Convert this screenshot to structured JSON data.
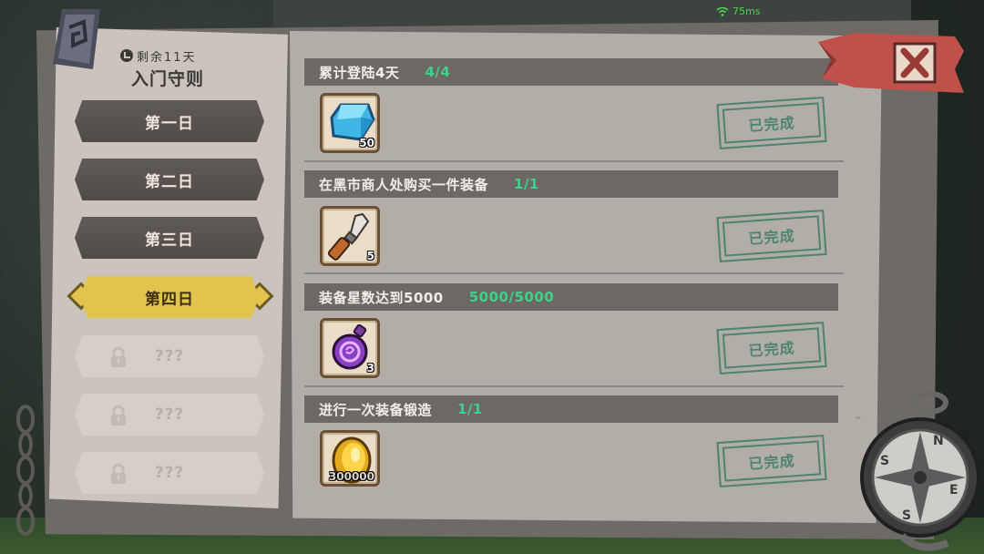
{
  "status_bar": {
    "ping": "75ms"
  },
  "sidebar": {
    "remaining": "剩余11天",
    "title": "入门守则",
    "days": [
      {
        "label": "第一日",
        "state": "normal"
      },
      {
        "label": "第二日",
        "state": "normal"
      },
      {
        "label": "第三日",
        "state": "normal"
      },
      {
        "label": "第四日",
        "state": "active"
      },
      {
        "label": "???",
        "state": "locked"
      },
      {
        "label": "???",
        "state": "locked"
      },
      {
        "label": "???",
        "state": "locked"
      }
    ]
  },
  "tasks": [
    {
      "title": "累计登陆4天",
      "progress": "4/4",
      "reward_icon": "blue-crystal-icon",
      "reward_count": "50",
      "status": "已完成"
    },
    {
      "title": "在黑市商人处购买一件装备",
      "progress": "1/1",
      "reward_icon": "chisel-icon",
      "reward_count": "5",
      "status": "已完成"
    },
    {
      "title": "装备星数达到5000",
      "progress": "5000/5000",
      "reward_icon": "purple-potion-icon",
      "reward_count": "3",
      "status": "已完成"
    },
    {
      "title": "进行一次装备锻造",
      "progress": "1/1",
      "reward_icon": "gold-coin-icon",
      "reward_count": "300000",
      "status": "已完成"
    }
  ],
  "compass": {
    "letters": [
      "N",
      "E",
      "S",
      "S"
    ]
  },
  "colors": {
    "progress": "#3fd08a",
    "active_day": "#e1c44e",
    "stamp": "#4e8470",
    "close_banner": "#c0504a"
  }
}
